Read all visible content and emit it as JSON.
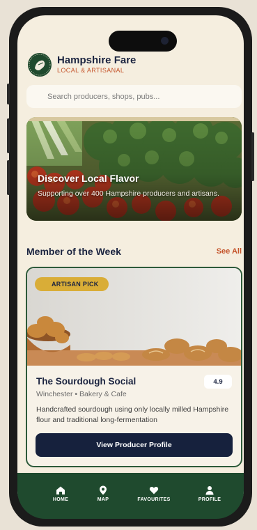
{
  "brand": {
    "title": "Hampshire Fare",
    "subtitle": "LOCAL & ARTISANAL"
  },
  "search": {
    "placeholder": "Search producers, shops, pubs..."
  },
  "hero": {
    "title": "Discover Local Flavor",
    "description": "Supporting over 400 Hampshire producers and artisans."
  },
  "member_section": {
    "title": "Member of the Week",
    "see_all": "See All"
  },
  "featured": {
    "badge": "ARTISAN PICK",
    "name": "The Sourdough Social",
    "rating": "4.9",
    "meta": "Winchester • Bakery & Cafe",
    "description": "Handcrafted sourdough using only locally milled Hampshire flour and traditional long-fermentation",
    "button": "View Producer Profile"
  },
  "nav": {
    "items": [
      {
        "label": "HOME",
        "icon": "home-icon"
      },
      {
        "label": "MAP",
        "icon": "map-pin-icon"
      },
      {
        "label": "FAVOURITES",
        "icon": "heart-icon"
      },
      {
        "label": "PROFILE",
        "icon": "user-icon"
      }
    ]
  },
  "colors": {
    "background": "#f5eedf",
    "primary_green": "#1f4a2e",
    "accent_orange": "#c5542b",
    "navy": "#16213d",
    "badge_gold": "#d9ad37"
  }
}
